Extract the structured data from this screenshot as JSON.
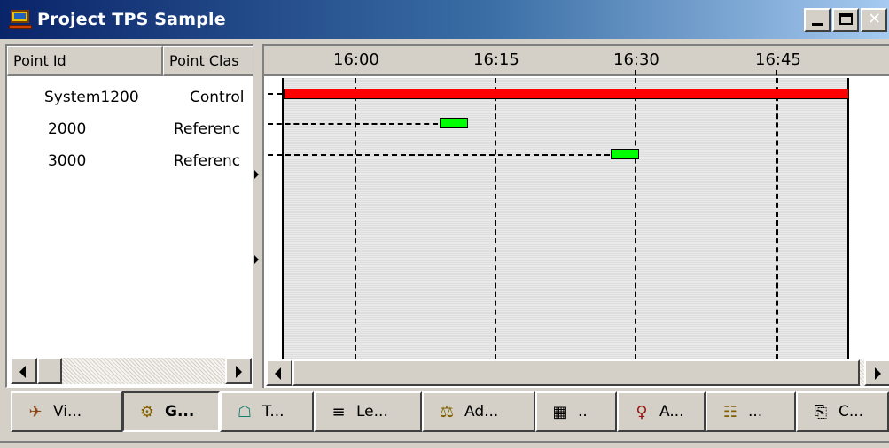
{
  "window": {
    "title": "Project TPS Sample",
    "icon": "computer-icon",
    "buttons": {
      "minimize": "minimize-icon",
      "maximize": "maximize-icon",
      "close": "✕"
    }
  },
  "list": {
    "columns": [
      "Point Id",
      "Point Clas"
    ],
    "rows": [
      {
        "id": "System1200",
        "class": "Control"
      },
      {
        "id": "2000",
        "class": "Referenc"
      },
      {
        "id": "3000",
        "class": "Referenc"
      }
    ]
  },
  "gantt": {
    "time_labels": [
      "16:00",
      "16:15",
      "16:30",
      "16:45"
    ],
    "bar_colors": {
      "control": "#ff0000",
      "reference": "#00ff00"
    },
    "bars": [
      {
        "row": "System1200",
        "color": "#ff0000"
      },
      {
        "row": "2000",
        "color": "#00ff00"
      },
      {
        "row": "3000",
        "color": "#00ff00"
      }
    ]
  },
  "tabs": [
    {
      "label": "Vi...",
      "icon": "view-icon"
    },
    {
      "label": "G...",
      "icon": "gears-icon"
    },
    {
      "label": "T...",
      "icon": "tower-icon"
    },
    {
      "label": "Le...",
      "icon": "level-icon"
    },
    {
      "label": "Ad...",
      "icon": "adjust-balance-icon"
    },
    {
      "label": "..",
      "icon": "grid-icon"
    },
    {
      "label": "A...",
      "icon": "antenna-icon"
    },
    {
      "label": "...",
      "icon": "report-icon"
    },
    {
      "label": "C...",
      "icon": "clipboard-icon"
    }
  ]
}
